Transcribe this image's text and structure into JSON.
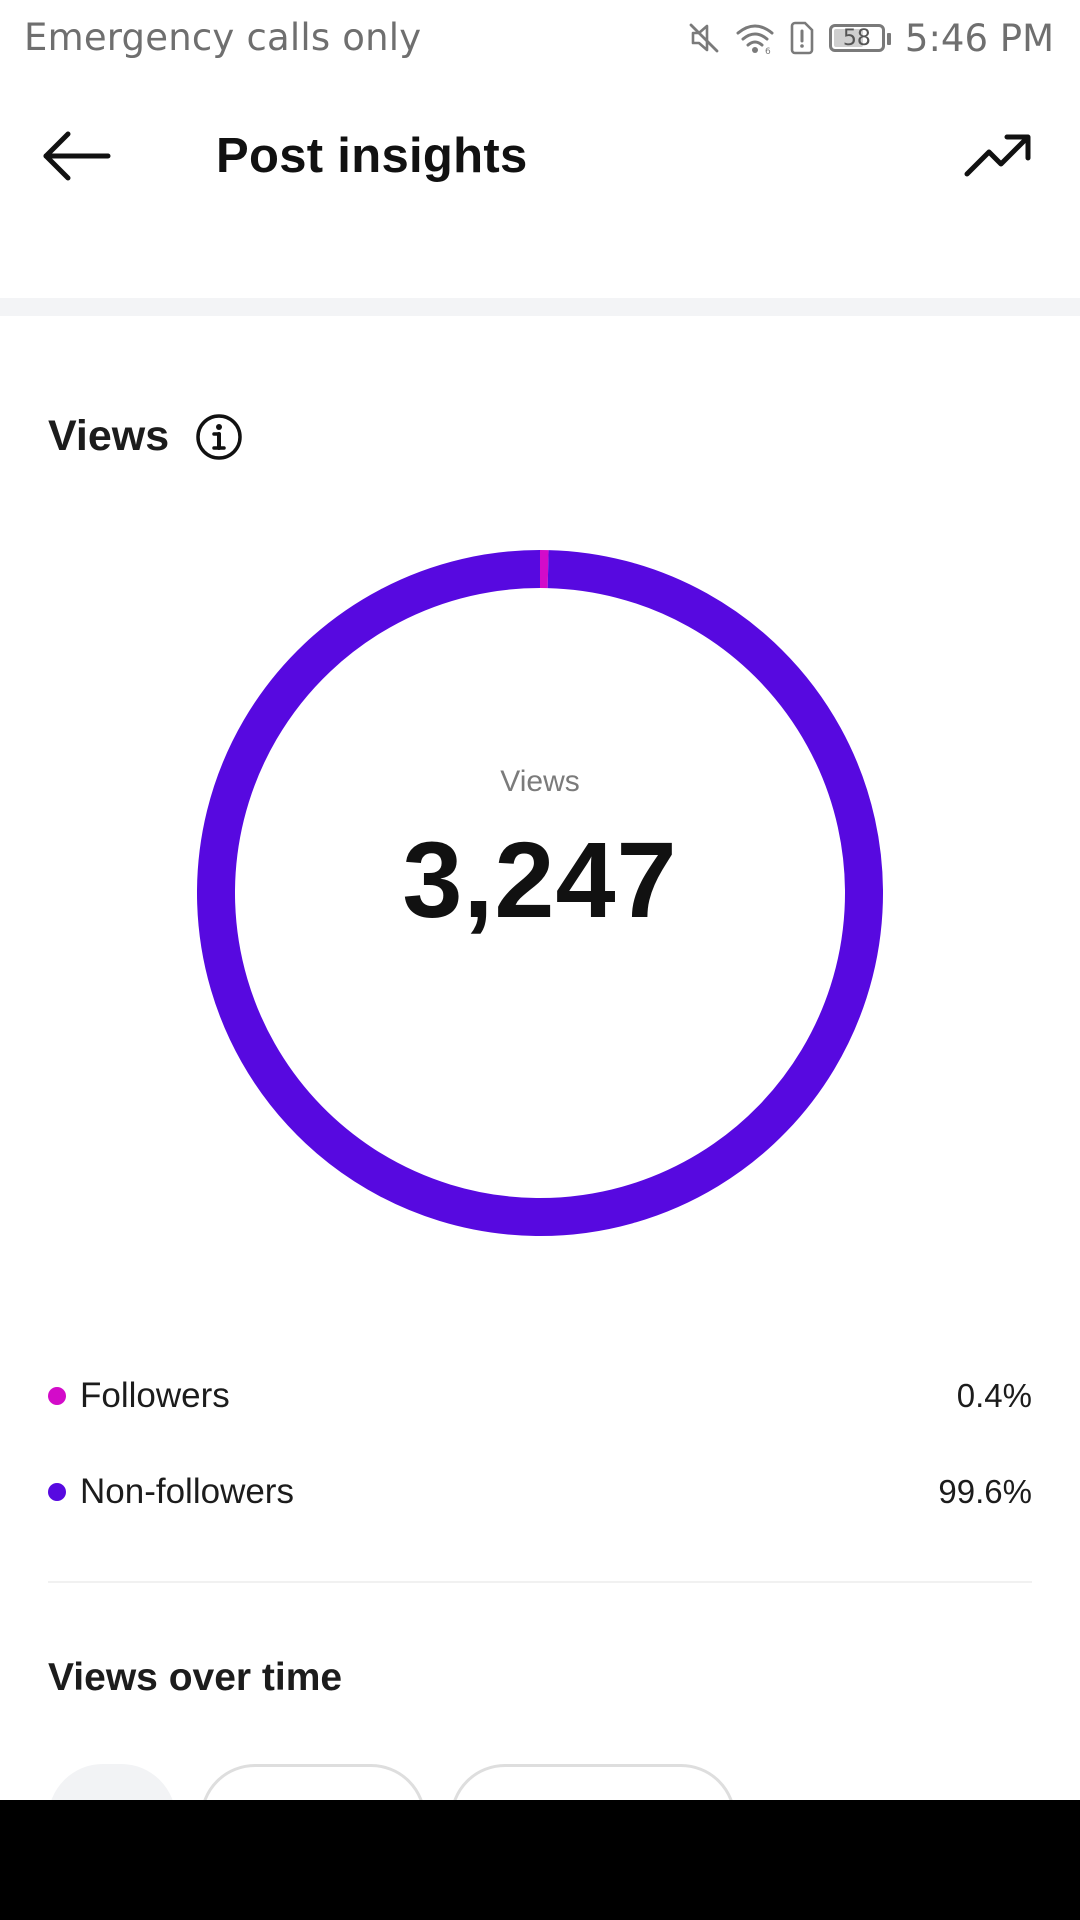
{
  "status_bar": {
    "carrier_text": "Emergency calls only",
    "battery_level": "58",
    "time": "5:46 PM",
    "icons": [
      "mute-icon",
      "wifi-icon",
      "sim-alert-icon",
      "battery-icon"
    ]
  },
  "header": {
    "title": "Post insights",
    "back_icon": "arrow-left-icon",
    "trend_icon": "trending-up-icon"
  },
  "views": {
    "heading": "Views",
    "info_icon": "info-icon",
    "center_label": "Views",
    "total": "3,247"
  },
  "chart_data": {
    "type": "pie",
    "series": [
      {
        "name": "Followers",
        "value": 0.4,
        "color": "#d30bc9"
      },
      {
        "name": "Non-followers",
        "value": 99.6,
        "color": "#5709e0"
      }
    ],
    "center_label": "Views",
    "center_value": "3,247"
  },
  "legend": [
    {
      "label": "Followers",
      "value": "0.4%",
      "color": "#d30bc9"
    },
    {
      "label": "Non-followers",
      "value": "99.6%",
      "color": "#5709e0"
    }
  ],
  "views_over_time": {
    "heading": "Views over time"
  },
  "colors": {
    "accent": "#5709e0",
    "secondary": "#d30bc9",
    "divider": "#f3f4f6"
  }
}
